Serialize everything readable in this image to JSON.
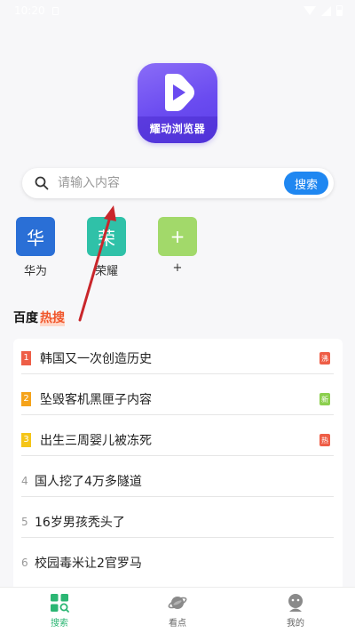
{
  "status": {
    "time": "10:20"
  },
  "app": {
    "logo_text": "耀动浏览器",
    "accent": "#6a4bf0"
  },
  "search": {
    "placeholder": "请输入内容",
    "button_label": "搜索"
  },
  "shortcuts": [
    {
      "glyph": "华",
      "label": "华为",
      "color": "#2a6fd6"
    },
    {
      "glyph": "荣",
      "label": "荣耀",
      "color": "#2fc1a8"
    },
    {
      "glyph": "+",
      "label": "+",
      "color": "#a2d96a"
    }
  ],
  "hot": {
    "title": "百度",
    "badge": "热搜",
    "items": [
      {
        "rank": "1",
        "text": "韩国又一次创造历史",
        "tag": "沸",
        "rank_color": "#ee5e47",
        "tag_color": "#ee5e47"
      },
      {
        "rank": "2",
        "text": "坠毁客机黑匣子内容",
        "tag": "新",
        "rank_color": "#f5a31a",
        "tag_color": "#8ccf4f"
      },
      {
        "rank": "3",
        "text": "出生三周婴儿被冻死",
        "tag": "热",
        "rank_color": "#f5c518",
        "tag_color": "#ee5e47"
      },
      {
        "rank": "4",
        "text": "国人挖了4万多隧道",
        "tag": ""
      },
      {
        "rank": "5",
        "text": "16岁男孩秃头了",
        "tag": ""
      },
      {
        "rank": "6",
        "text": "校园毒米让2官罗马",
        "tag": ""
      }
    ]
  },
  "tabbar": {
    "tabs": [
      {
        "label": "搜索",
        "icon": "grid-search-icon",
        "active": true
      },
      {
        "label": "看点",
        "icon": "planet-icon",
        "active": false
      },
      {
        "label": "我的",
        "icon": "user-icon",
        "active": false
      }
    ],
    "active_color": "#2bb673"
  }
}
